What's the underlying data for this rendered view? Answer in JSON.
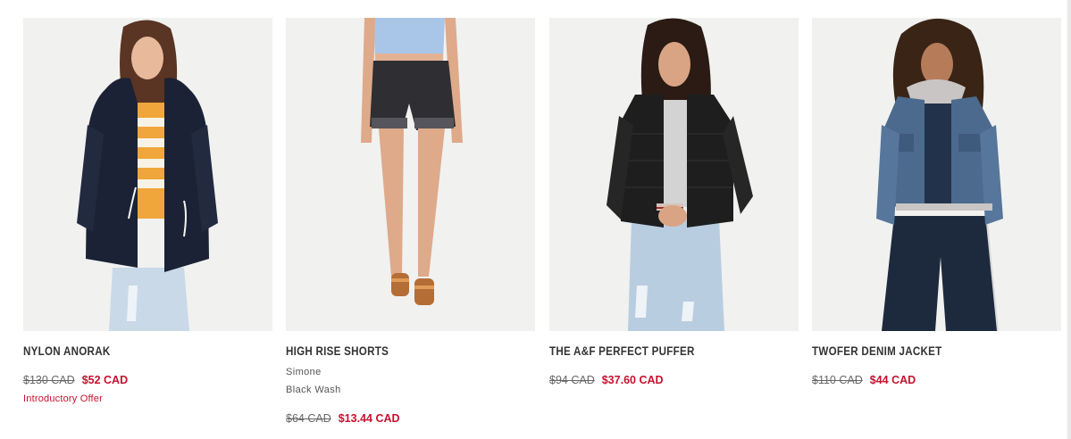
{
  "products": [
    {
      "name": "NYLON ANORAK",
      "was_price": "$130 CAD",
      "sale_price": "$52 CAD",
      "promo": "Introductory Offer",
      "photo_icon": "model-anorak-photo",
      "colors": {
        "garment": "#1b2235",
        "accent": "#f0a63a"
      }
    },
    {
      "name": "HIGH RISE SHORTS",
      "fit": "Simone",
      "wash": "Black Wash",
      "was_price": "$64 CAD",
      "sale_price": "$13.44 CAD",
      "photo_icon": "model-shorts-photo",
      "colors": {
        "garment": "#2f2f33",
        "accent": "#a9c6e8"
      }
    },
    {
      "name": "THE A&F PERFECT PUFFER",
      "was_price": "$94 CAD",
      "sale_price": "$37.60 CAD",
      "photo_icon": "model-puffer-photo",
      "colors": {
        "garment": "#1e1e1f",
        "accent": "#b9cde0"
      }
    },
    {
      "name": "TWOFER DENIM JACKET",
      "was_price": "$110 CAD",
      "sale_price": "$44 CAD",
      "photo_icon": "model-denim-photo",
      "colors": {
        "garment": "#4b6a8e",
        "accent": "#1d2a3d"
      }
    }
  ],
  "theme": {
    "sale_color": "#c8102e",
    "text_color": "#333333",
    "photo_bg": "#f1f1f0"
  }
}
